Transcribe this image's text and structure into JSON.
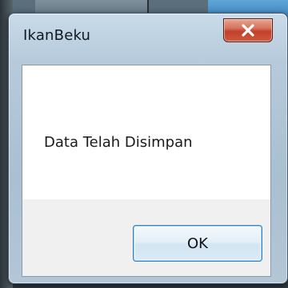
{
  "window": {
    "title": "IkanBeku",
    "close_icon": "close-icon"
  },
  "dialog": {
    "message": "Data Telah Disimpan",
    "ok_label": "OK"
  },
  "colors": {
    "close_button": "#c1402a",
    "ok_border": "#3c7fb1",
    "content_bg": "#ffffff",
    "footer_bg": "#f0f0f0"
  }
}
